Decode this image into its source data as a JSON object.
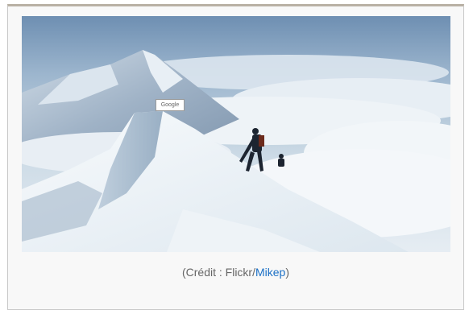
{
  "figure": {
    "google_tag": "Google",
    "caption": {
      "prefix": "(Crédit : Flickr/",
      "link_text": "Mikep",
      "suffix": ")"
    }
  },
  "colors": {
    "frame_border_top": "#b9b1a4",
    "frame_background": "#f8f8f8",
    "caption_text": "#666666",
    "link": "#1a6fc5"
  }
}
